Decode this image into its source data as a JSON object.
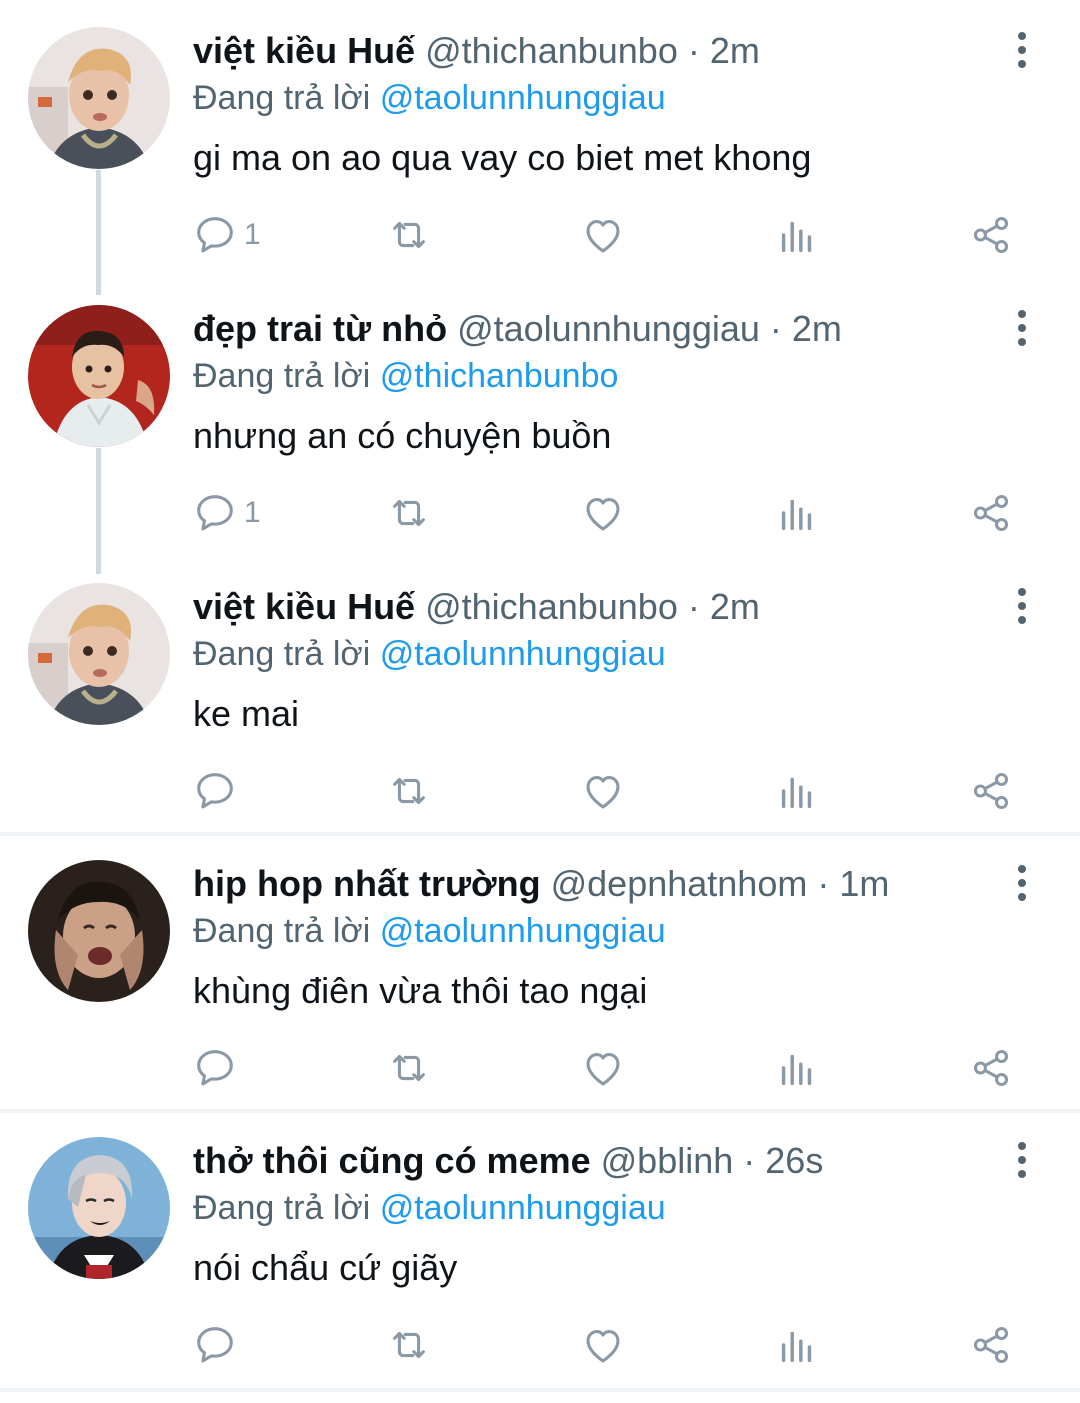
{
  "tweets": [
    {
      "name": "việt kiều Huế",
      "handle": "@thichanbunbo",
      "time": "· 2m",
      "replying_prefix": "Đang trả lời ",
      "replying_to": "@taolunnhunggiau",
      "text": "gi ma on ao qua vay co biet met khong",
      "reply_count": "1"
    },
    {
      "name": "đẹp trai từ nhỏ",
      "handle": "@taolunnhunggiau",
      "time": "· 2m",
      "replying_prefix": "Đang trả lời ",
      "replying_to": "@thichanbunbo",
      "text": "nhưng an có chuyện buồn",
      "reply_count": "1"
    },
    {
      "name": "việt kiều Huế",
      "handle": "@thichanbunbo",
      "time": "· 2m",
      "replying_prefix": "Đang trả lời ",
      "replying_to": "@taolunnhunggiau",
      "text": "ke mai",
      "reply_count": ""
    },
    {
      "name": "hip hop nhất trường",
      "handle": "@depnhatnhom",
      "time": "· 1m",
      "replying_prefix": "Đang trả lời ",
      "replying_to": "@taolunnhunggiau",
      "text": "khùng điên vừa thôi tao ngại",
      "reply_count": ""
    },
    {
      "name": "thở thôi cũng có meme",
      "handle": "@bblinh",
      "time": "· 26s",
      "replying_prefix": "Đang trả lời ",
      "replying_to": "@taolunnhunggiau",
      "text": "nói chẩu cứ giãy",
      "reply_count": ""
    }
  ],
  "icons": {
    "reply": "reply-icon",
    "retweet": "retweet-icon",
    "like": "heart-icon",
    "views": "analytics-icon",
    "share": "share-icon",
    "more": "more-vertical-icon"
  },
  "colors": {
    "name": "#0f1419",
    "secondary": "#536471",
    "mention": "#1d9bf0",
    "icon": "#8b98a5",
    "thread_line": "#cfd9de"
  }
}
